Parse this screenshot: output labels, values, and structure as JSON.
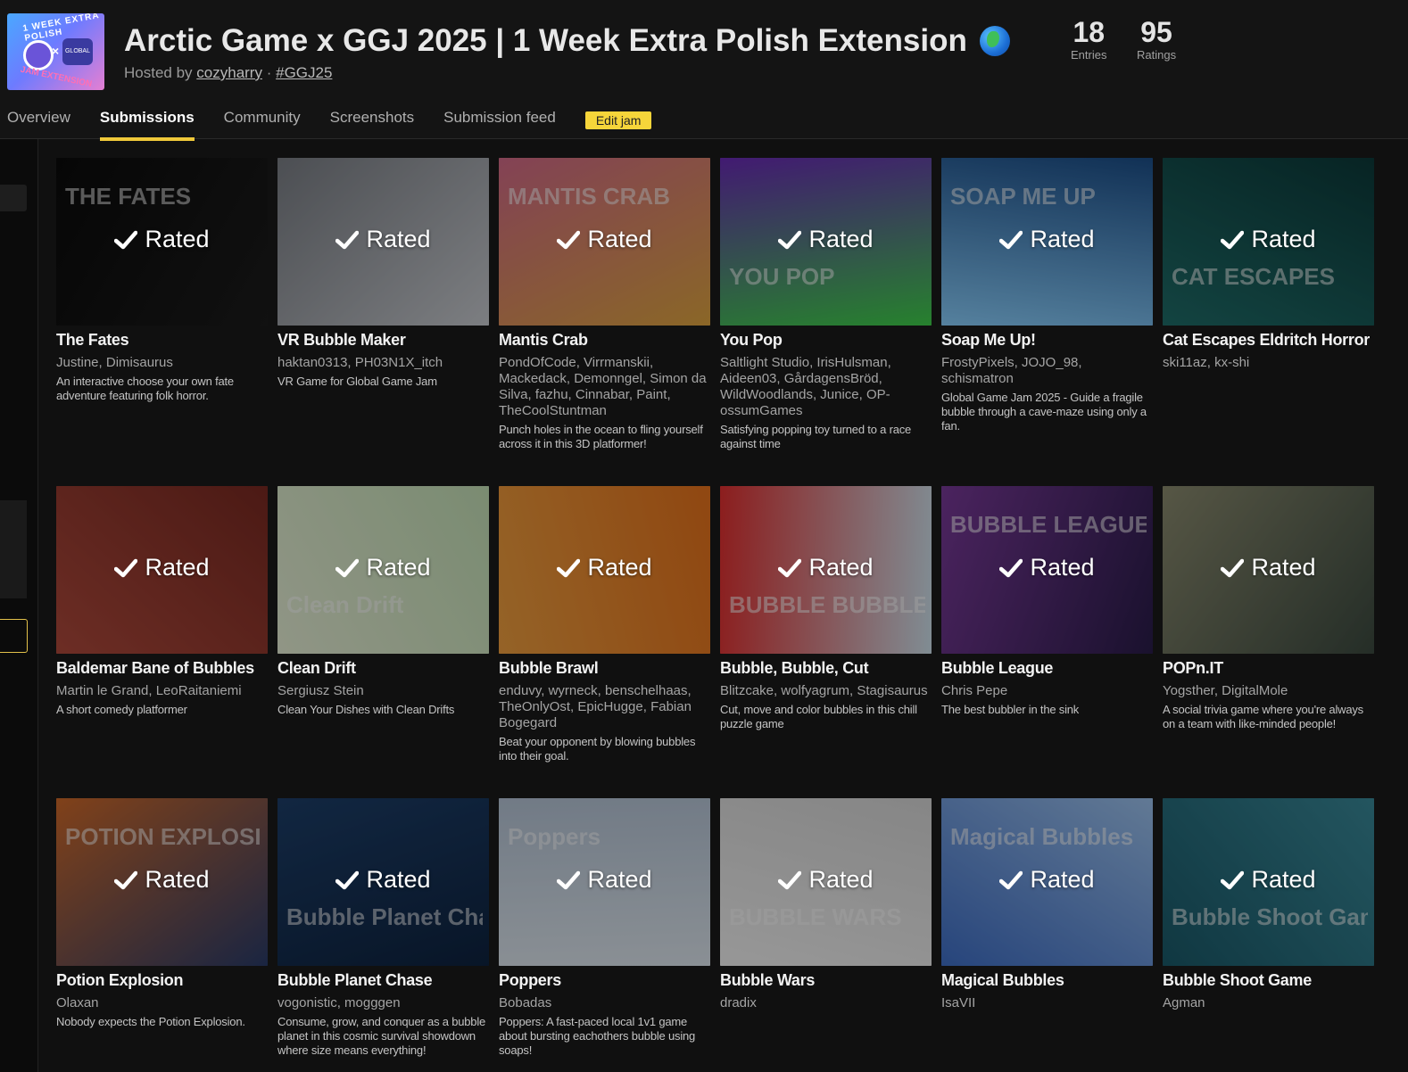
{
  "jam": {
    "title": "Arctic Game x GGJ 2025 | 1 Week Extra Polish Extension",
    "hosted_prefix": "Hosted by",
    "host": "cozyharry",
    "separator": "·",
    "hashtag": "#GGJ25",
    "thumb_line1": "1 WEEK EXTRA POLISH",
    "thumb_line2": "JAM EXTENSION",
    "thumb_logo": "GLOBAL"
  },
  "stats": [
    {
      "value": "18",
      "label": "Entries"
    },
    {
      "value": "95",
      "label": "Ratings"
    }
  ],
  "nav": {
    "tabs": [
      "Overview",
      "Submissions",
      "Community",
      "Screenshots",
      "Submission feed"
    ],
    "active": "Submissions",
    "edit_label": "Edit jam"
  },
  "rated_label": "Rated",
  "entries": [
    {
      "name": "The Fates",
      "authors": "Justine, Dimisaurus",
      "desc": "An interactive choose your own fate adventure featuring folk horror.",
      "art_text": "THE FATES",
      "colors": [
        "#0b0b0b",
        "#1c1c1c"
      ]
    },
    {
      "name": "VR Bubble Maker",
      "authors": "haktan0313, PH03N1X_itch",
      "desc": "VR Game for Global Game Jam",
      "art_text": "",
      "colors": [
        "#7b7f86",
        "#c9ccd1"
      ]
    },
    {
      "name": "Mantis Crab",
      "authors": "PondOfCode, Virrmanskii, Mackedack, Demonngel, Simon da Silva, fazhu, Cinnabar, Paint, TheCoolStuntman",
      "desc": "Punch holes in the ocean to fling yourself across it in this 3D platformer!",
      "art_text": "MANTIS CRAB",
      "colors": [
        "#d46b8a",
        "#e0a640"
      ]
    },
    {
      "name": "You Pop",
      "authors": "Saltlight Studio, IrisHulsman, Aideen03, GårdagensBröd, WildWoodlands, Junice, OP-ossumGames",
      "desc": "Satisfying popping toy turned to a race against time",
      "art_text": "YOU POP",
      "colors": [
        "#6b2bb8",
        "#3fd14a"
      ]
    },
    {
      "name": "Soap Me Up!",
      "authors": "FrostyPixels, JOJO_98, schismatron",
      "desc": "Global Game Jam 2025 - Guide a fragile bubble through a cave-maze using only a fan.",
      "art_text": "SOAP ME UP",
      "colors": [
        "#1c4f8a",
        "#8ad0ff"
      ]
    },
    {
      "name": "Cat Escapes Eldritch Horror",
      "authors": "ski11az, kx-shi",
      "desc": "",
      "art_text": "CAT ESCAPES",
      "colors": [
        "#0c3a3a",
        "#1f6e6a"
      ]
    },
    {
      "name": "Baldemar Bane of Bubbles",
      "authors": "Martin le Grand, LeoRaitaniemi",
      "desc": "A short comedy platformer",
      "art_text": "",
      "colors": [
        "#7a2a22",
        "#b04a3c"
      ]
    },
    {
      "name": "Clean Drift",
      "authors": "Sergiusz Stein",
      "desc": "Clean Your Dishes with Clean Drifts",
      "art_text": "Clean Drift",
      "colors": [
        "#c6e2b8",
        "#e9f1d8"
      ]
    },
    {
      "name": "Bubble Brawl",
      "authors": "enduvy, wyrneck, benschelhaas, TheOnlyOst, EpicHugge, Fabian Bogegard",
      "desc": "Beat your opponent by blowing bubbles into their goal.",
      "art_text": "",
      "colors": [
        "#e8731c",
        "#f0a040"
      ]
    },
    {
      "name": "Bubble, Bubble, Cut",
      "authors": "Blitzcake, wolfyagrum, Stagisaurus",
      "desc": "Cut, move and color bubbles in this chill puzzle game",
      "art_text": "BUBBLE BUBBLE CUT",
      "colors": [
        "#cfe3ee",
        "#e23030"
      ]
    },
    {
      "name": "Bubble League",
      "authors": "Chris Pepe",
      "desc": "The best bubbler in the sink",
      "art_text": "BUBBLE LEAGUE",
      "colors": [
        "#2a1c4a",
        "#7a3a9a"
      ]
    },
    {
      "name": "POPn.IT",
      "authors": "Yogsther, DigitalMole",
      "desc": "A social trivia game where you're always on a team with like-minded people!",
      "art_text": "",
      "colors": [
        "#3c4a40",
        "#8c8c70"
      ]
    },
    {
      "name": "Potion Explosion",
      "authors": "Olaxan",
      "desc": "Nobody expects the Potion Explosion.",
      "art_text": "POTION EXPLOSION",
      "colors": [
        "#2a3c6a",
        "#d06a2a"
      ]
    },
    {
      "name": "Bubble Planet Chase",
      "authors": "vogonistic, mogggen",
      "desc": "Consume, grow, and conquer as a bubble planet in this cosmic survival showdown where size means everything!",
      "art_text": "Bubble Planet Chase",
      "colors": [
        "#0e2340",
        "#1d3f6a"
      ]
    },
    {
      "name": "Poppers",
      "authors": "Bobadas",
      "desc": "Poppers: A fast-paced local 1v1 game about bursting eachothers bubble using soaps!",
      "art_text": "Poppers",
      "colors": [
        "#dfe8f0",
        "#b7c6d8"
      ]
    },
    {
      "name": "Bubble Wars",
      "authors": "dradix",
      "desc": "",
      "art_text": "BUBBLE WARS",
      "colors": [
        "#f4f4f4",
        "#d8d8d8"
      ]
    },
    {
      "name": "Magical Bubbles",
      "authors": "IsaVII",
      "desc": "",
      "art_text": "Magical Bubbles",
      "colors": [
        "#3f6fc8",
        "#9ec4f0"
      ]
    },
    {
      "name": "Bubble Shoot Game",
      "authors": "Agman",
      "desc": "",
      "art_text": "Bubble Shoot Game",
      "colors": [
        "#1a5a6a",
        "#3a8a9a"
      ]
    }
  ]
}
